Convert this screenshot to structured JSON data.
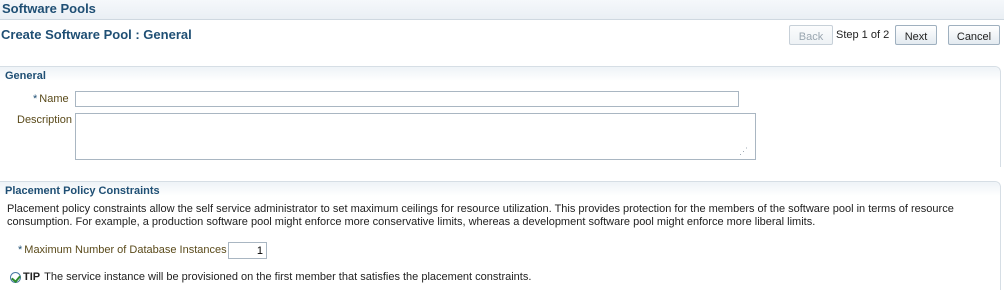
{
  "header": {
    "app_title": "Software Pools"
  },
  "page": {
    "title": "Create Software Pool : General"
  },
  "train": {
    "back_label": "Back",
    "step_label": "Step 1 of 2",
    "next_label": "Next",
    "cancel_label": "Cancel"
  },
  "general": {
    "title": "General",
    "name_label": "Name",
    "name_value": "",
    "description_label": "Description",
    "description_value": "",
    "required_marker": "*"
  },
  "placement": {
    "title": "Placement Policy Constraints",
    "description": "Placement policy constraints allow the self service administrator to set maximum ceilings for resource utilization. This provides protection for the members of the software pool in terms of resource consumption. For example, a production software pool might enforce more conservative limits, whereas a development software pool might enforce more liberal limits.",
    "max_db_label": "Maximum Number of Database Instances",
    "max_db_value": "1",
    "required_marker": "*",
    "tip_label": "TIP",
    "tip_text": "The service instance will be provisioned on the first member that satisfies the placement constraints."
  },
  "icons": {
    "tip": "tip-check-icon",
    "resize": "resize-grip-icon"
  },
  "colors": {
    "header_text": "#1f4f74",
    "required_star": "#1f4f74"
  }
}
